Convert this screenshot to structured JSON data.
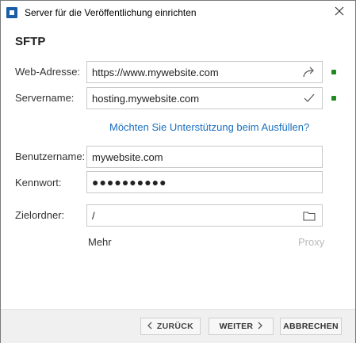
{
  "window": {
    "title": "Server für die Veröffentlichung einrichten"
  },
  "section": {
    "title": "SFTP"
  },
  "fields": {
    "web_address": {
      "label": "Web-Adresse:",
      "value": "https://www.mywebsite.com"
    },
    "servername": {
      "label": "Servername:",
      "value": "hosting.mywebsite.com"
    },
    "username": {
      "label": "Benutzername:",
      "value": "mywebsite.com"
    },
    "password": {
      "label": "Kennwort:",
      "value": "●●●●●●●●●●"
    },
    "target_folder": {
      "label": "Zielordner:",
      "value": "/"
    }
  },
  "help_link": "Möchten Sie Unterstützung beim Ausfüllen?",
  "more_label": "Mehr",
  "proxy_label": "Proxy",
  "buttons": {
    "back": "ZURÜCK",
    "next": "WEITER",
    "cancel": "ABBRECHEN"
  },
  "icons": {
    "app": "app-icon",
    "close": "close-icon",
    "open_url": "share-arrow-icon",
    "verified": "checkmark-icon",
    "folder": "folder-icon",
    "back": "chevron-left-icon",
    "next": "chevron-right-icon"
  },
  "colors": {
    "accent": "#1b5ea8",
    "link": "#1a6fbf",
    "status_ok": "#1f8a1f"
  }
}
